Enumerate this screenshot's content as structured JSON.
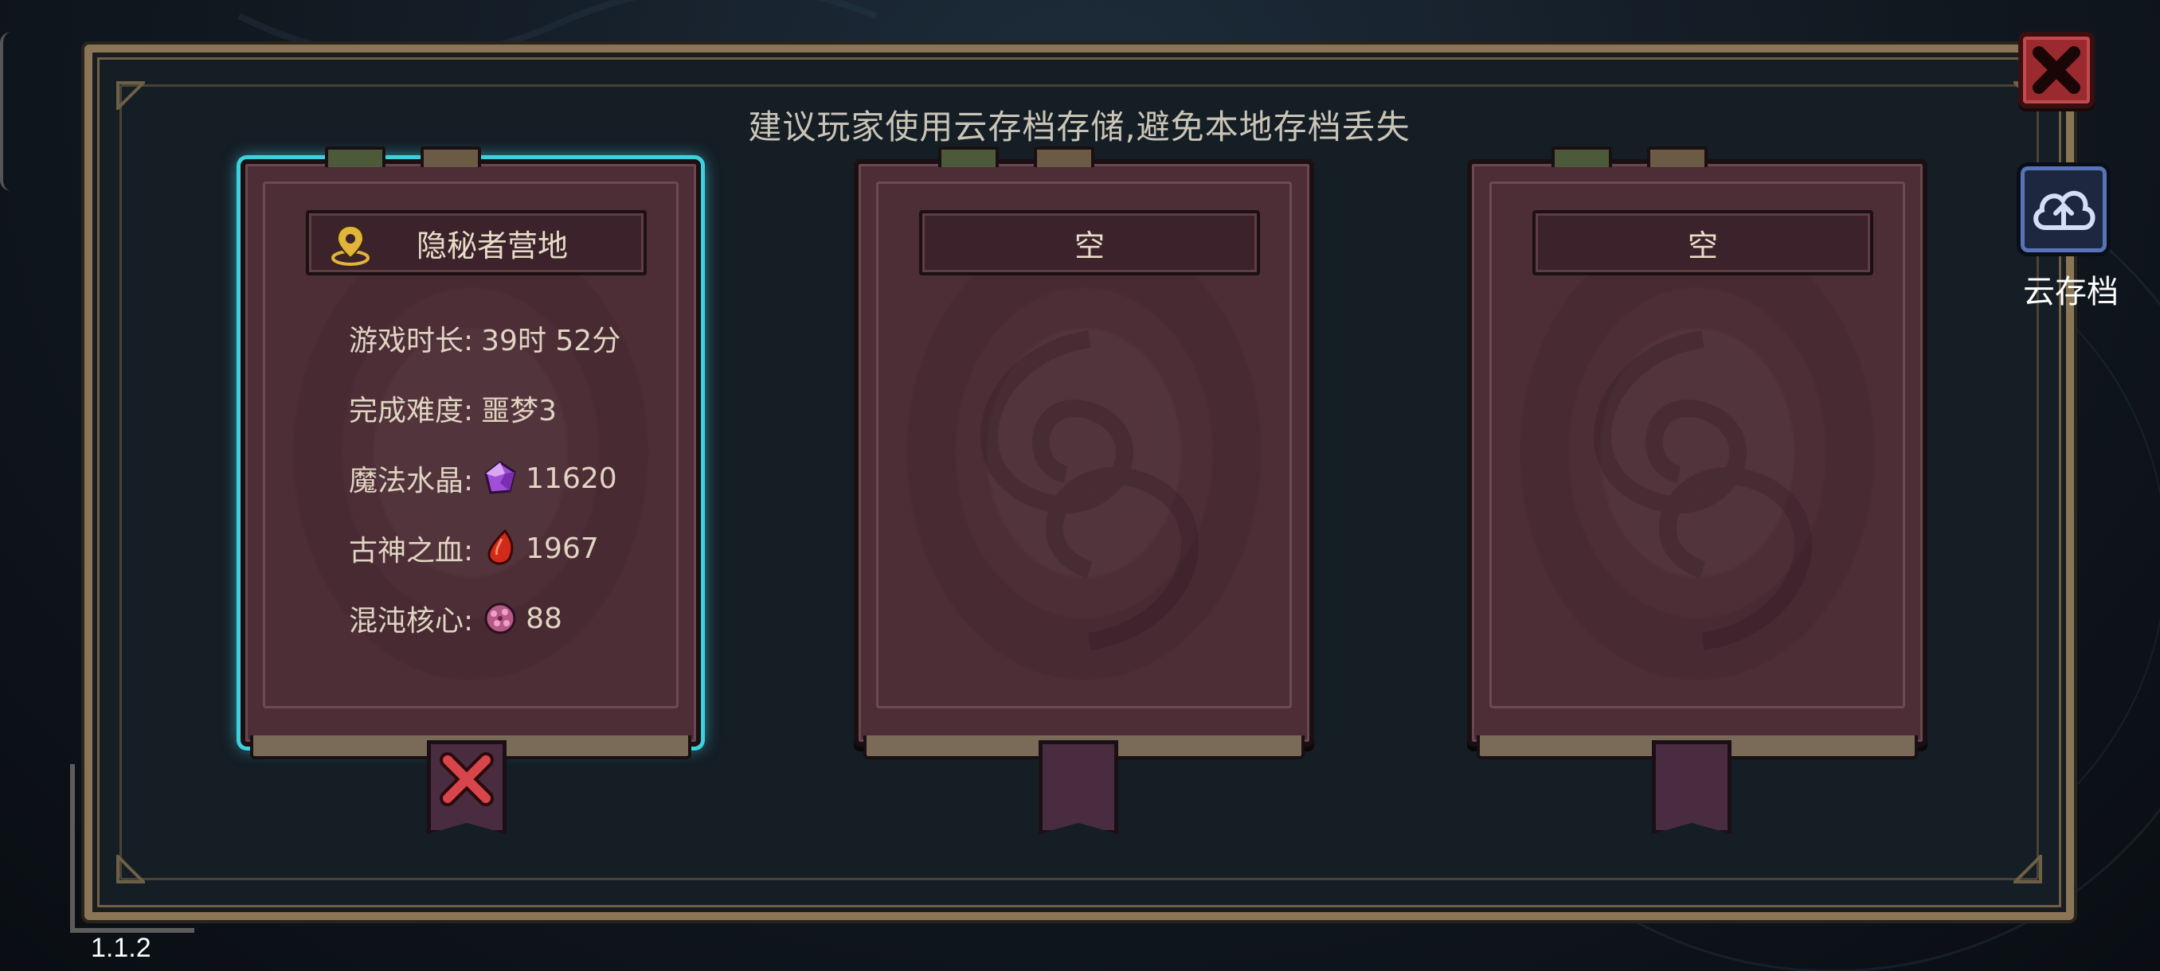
{
  "hint_text": "建议玩家使用云存档存储,避免本地存档丢失",
  "close_icon": "close-x-icon",
  "cloud_save": {
    "label": "云存档",
    "icon": "cloud-upload-icon"
  },
  "version": "1.1.2",
  "accent_color": "#3fd0de",
  "slots": [
    {
      "title": "隐秘者营地",
      "selected": true,
      "location_icon": "map-pin-icon",
      "stats": [
        {
          "label": "游戏时长:",
          "value": "39时 52分",
          "icon": null
        },
        {
          "label": "完成难度:",
          "value": "噩梦3",
          "icon": null
        },
        {
          "label": "魔法水晶:",
          "value": "11620",
          "icon": "crystal-icon"
        },
        {
          "label": "古神之血:",
          "value": "1967",
          "icon": "blood-drop-icon"
        },
        {
          "label": "混沌核心:",
          "value": "88",
          "icon": "chaos-core-icon"
        }
      ],
      "delete_icon": "delete-x-icon"
    },
    {
      "title": "空",
      "selected": false
    },
    {
      "title": "空",
      "selected": false
    }
  ]
}
